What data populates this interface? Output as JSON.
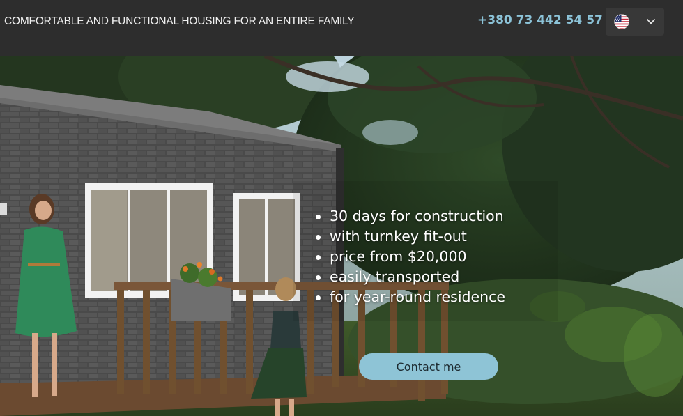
{
  "header": {
    "tagline": "COMFORTABLE AND FUNCTIONAL HOUSING FOR AN ENTIRE FAMILY",
    "phone": "+380 73 442 54 57",
    "language": {
      "flag_icon": "us-flag-icon",
      "dropdown_icon": "chevron-down-icon"
    }
  },
  "hero": {
    "features": [
      "30 days for construction",
      "with turnkey fit-out",
      "price from $20,000",
      "easily transported",
      "for year-round residence"
    ],
    "contact_button": "Contact me"
  },
  "colors": {
    "header_bg": "#2d2d2d",
    "phone": "#8cc3d8",
    "button_bg": "#8ec4d6"
  }
}
